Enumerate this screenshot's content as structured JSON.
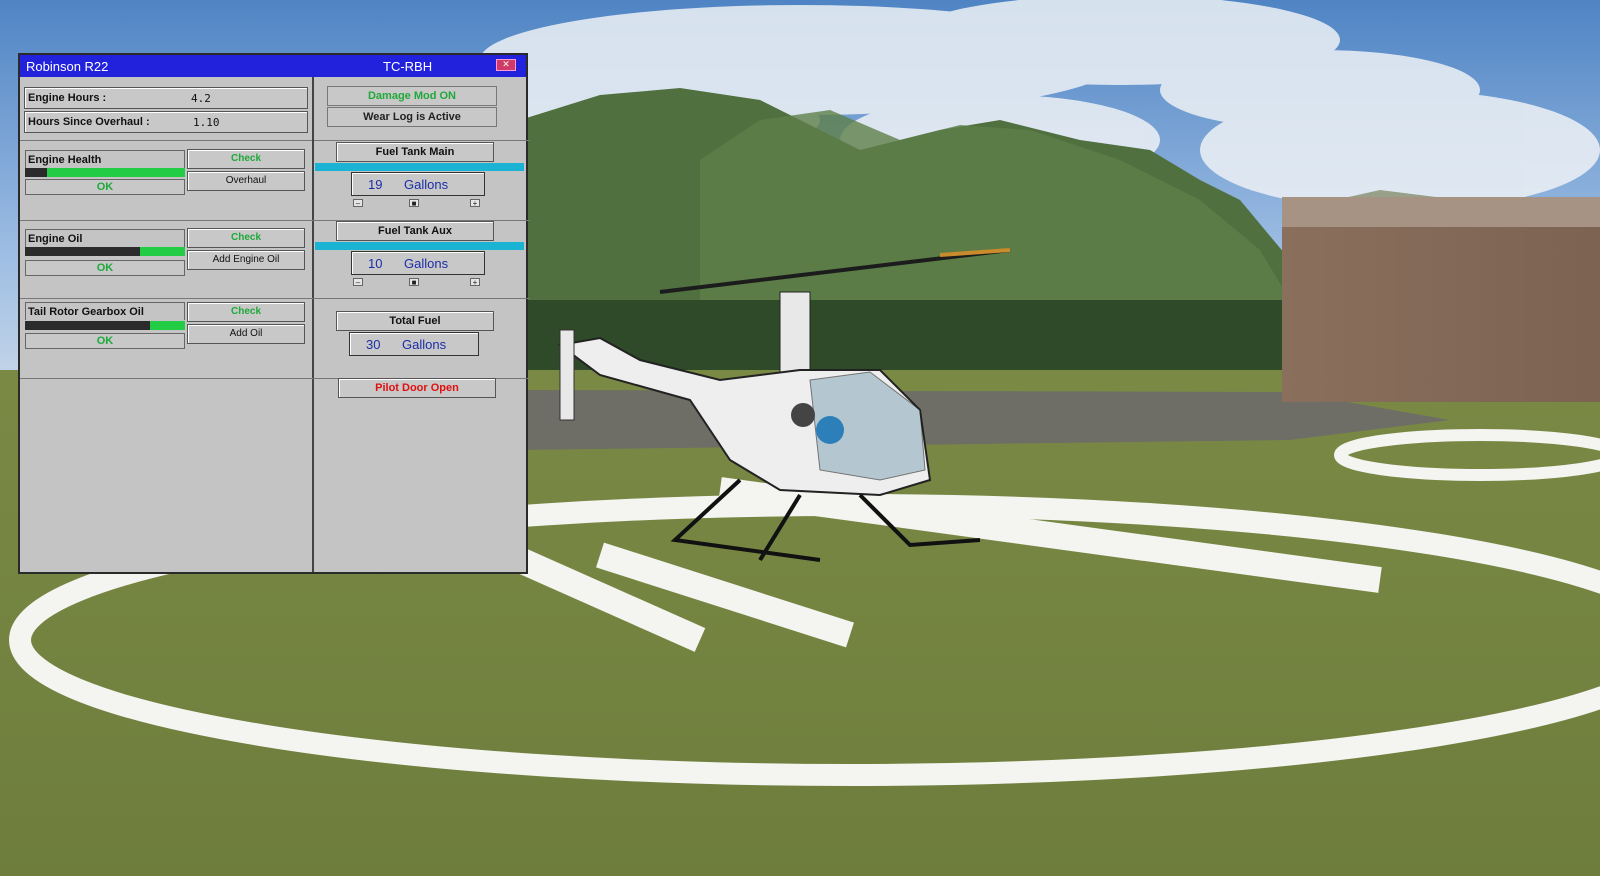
{
  "window": {
    "title": "Robinson R22",
    "registration": "TC-RBH",
    "close_symbol": "✕"
  },
  "hours": {
    "engine_label": "Engine  Hours :",
    "engine_value": "4.2",
    "overhaul_label": "Hours Since Overhaul :",
    "overhaul_value": "1.10"
  },
  "status": {
    "damage_mod": "Damage Mod ON",
    "wear_log": "Wear Log is Active"
  },
  "engine_health": {
    "label": "Engine  Health",
    "status": "OK",
    "level": 0.86,
    "check": "Check",
    "action": "Overhaul"
  },
  "engine_oil": {
    "label": "Engine  Oil",
    "status": "OK",
    "level": 0.28,
    "check": "Check",
    "action": "Add Engine Oil"
  },
  "tail_rotor": {
    "label": "Tail Rotor Gearbox Oil",
    "status": "OK",
    "level": 0.22,
    "check": "Check",
    "action": "Add Oil"
  },
  "fuel_main": {
    "label": "Fuel Tank Main",
    "value": "19",
    "unit": "Gallons",
    "minus": "–",
    "mid": "■",
    "plus": "+"
  },
  "fuel_aux": {
    "label": "Fuel Tank Aux",
    "value": "10",
    "unit": "Gallons",
    "minus": "–",
    "mid": "■",
    "plus": "+"
  },
  "fuel_total": {
    "label": "Total Fuel",
    "value": "30",
    "unit": "Gallons"
  },
  "pilot_door": "Pilot Door Open",
  "colors": {
    "title_bar": "#2222dd",
    "ok_green": "#1fa93a",
    "bar_green": "#22cc44",
    "alert_red": "#e01010",
    "gallons_blue": "#1a2ea8",
    "tank_cyan": "#1bb3d3"
  }
}
